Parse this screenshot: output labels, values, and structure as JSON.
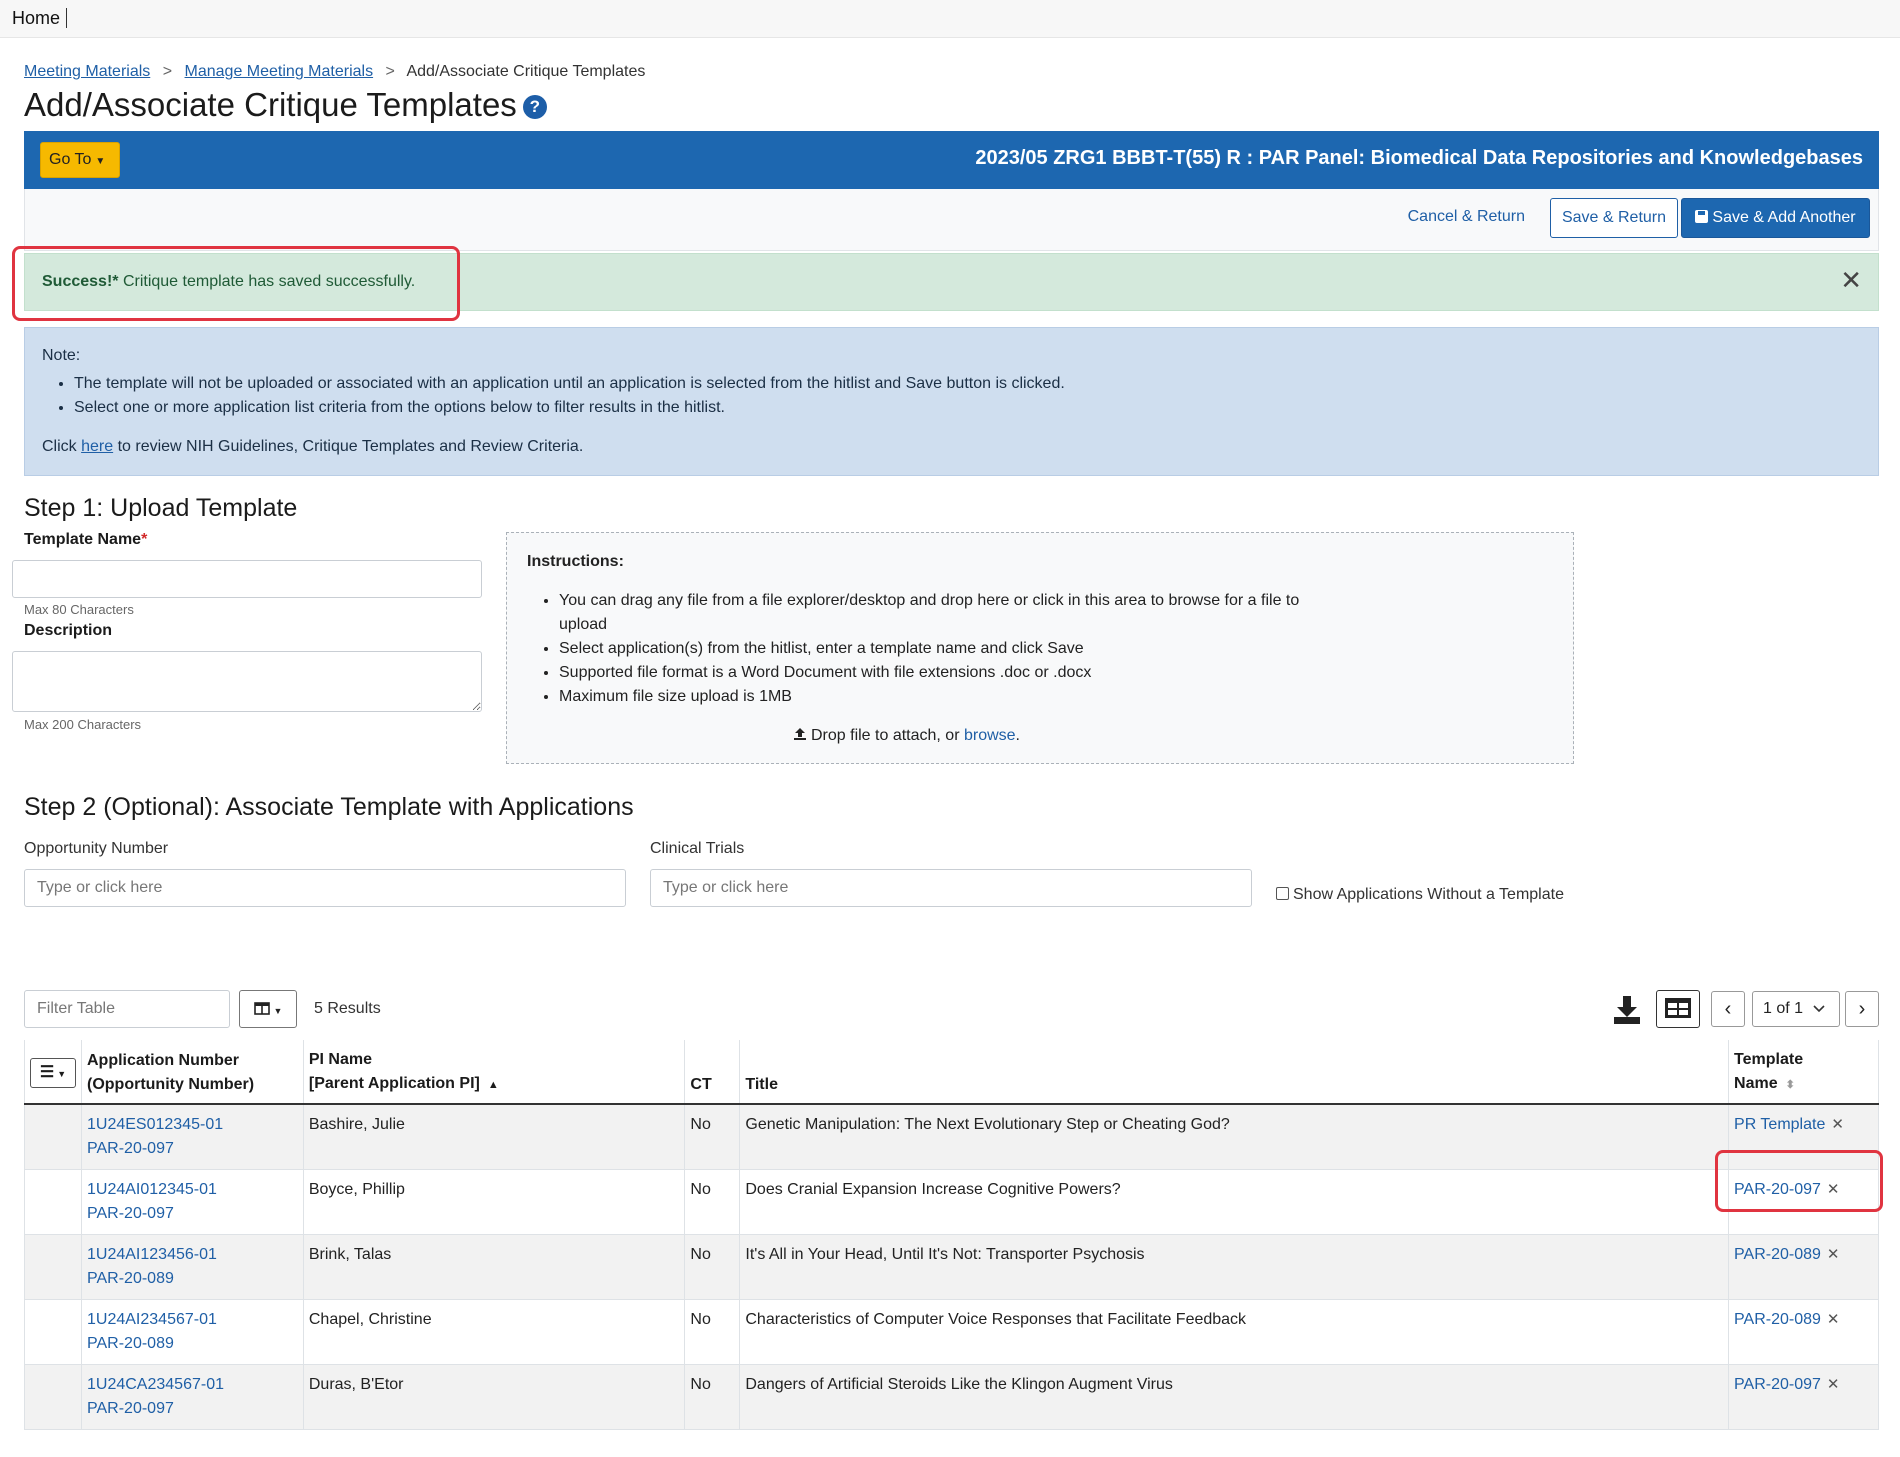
{
  "topbar": {
    "home": "Home"
  },
  "breadcrumb": {
    "items": [
      "Meeting Materials",
      "Manage Meeting Materials"
    ],
    "current": "Add/Associate Critique Templates",
    "separator": ">"
  },
  "page": {
    "title": "Add/Associate Critique Templates",
    "help_glyph": "?"
  },
  "header_bar": {
    "goto_label": "Go To",
    "meeting_title": "2023/05 ZRG1 BBBT-T(55) R : PAR Panel: Biomedical Data Repositories and Knowledgebases"
  },
  "actions": {
    "cancel_label": "Cancel & Return",
    "save_return_label": "Save & Return",
    "save_add_label": "Save & Add Another"
  },
  "alert": {
    "strong": "Success!*",
    "message": " Critique template has saved successfully.",
    "close": "✕"
  },
  "note": {
    "label": "Note:",
    "bullets": [
      "The template will not be uploaded or associated with an application until an application is selected from the hitlist and Save button is clicked.",
      "Select one or more application list criteria from the options below to filter results in the hitlist."
    ],
    "click_prefix": "Click ",
    "click_link": "here",
    "click_suffix": " to review NIH Guidelines, Critique Templates and Review Criteria."
  },
  "step1": {
    "title": "Step 1: Upload Template",
    "template_name_label": "Template Name",
    "template_name_required": "*",
    "template_name_value": "",
    "template_name_hint": "Max 80 Characters",
    "description_label": "Description",
    "description_value": "",
    "description_hint": "Max 200 Characters",
    "instructions_label": "Instructions:",
    "instructions": [
      "You can drag any file from a file explorer/desktop and drop here or click in this area to browse for a file to upload",
      "Select application(s) from the hitlist, enter a template name and click Save",
      "Supported file format is a Word Document with file extensions .doc or .docx",
      "Maximum file size upload is 1MB"
    ],
    "drop_text": "Drop file to attach, or ",
    "browse_link": "browse",
    "drop_end": "."
  },
  "step2": {
    "title": "Step 2 (Optional): Associate Template with Applications",
    "opportunity_label": "Opportunity Number",
    "opportunity_placeholder": "Type or click here",
    "clinical_label": "Clinical Trials",
    "clinical_placeholder": "Type or click here",
    "show_without_label": "Show Applications Without a Template"
  },
  "table_toolbar": {
    "filter_placeholder": "Filter Table",
    "results": "5 Results",
    "page_select": "1 of 1",
    "prev": "‹",
    "next": "›"
  },
  "table": {
    "headers": {
      "app_line1": "Application Number",
      "app_line2": "(Opportunity Number)",
      "pi_line1": "PI Name",
      "pi_line2": "[Parent Application PI]",
      "ct": "CT",
      "title": "Title",
      "tpl_line1": "Template",
      "tpl_line2": "Name"
    },
    "rows": [
      {
        "app": "1U24ES012345-01",
        "opp": "PAR-20-097",
        "pi": "Bashire, Julie",
        "ct": "No",
        "title": "Genetic Manipulation: The Next Evolutionary Step or Cheating God?",
        "template": "PR Template"
      },
      {
        "app": "1U24AI012345-01",
        "opp": "PAR-20-097",
        "pi": "Boyce, Phillip",
        "ct": "No",
        "title": "Does Cranial Expansion Increase Cognitive Powers?",
        "template": "PAR-20-097"
      },
      {
        "app": "1U24AI123456-01",
        "opp": "PAR-20-089",
        "pi": "Brink, Talas",
        "ct": "No",
        "title": "It's All in Your Head, Until It's Not: Transporter Psychosis",
        "template": "PAR-20-089"
      },
      {
        "app": "1U24AI234567-01",
        "opp": "PAR-20-089",
        "pi": "Chapel, Christine",
        "ct": "No",
        "title": "Characteristics of Computer Voice Responses that Facilitate Feedback",
        "template": "PAR-20-089"
      },
      {
        "app": "1U24CA234567-01",
        "opp": "PAR-20-097",
        "pi": "Duras, B'Etor",
        "ct": "No",
        "title": "Dangers of Artificial Steroids Like the Klingon Augment Virus",
        "template": "PAR-20-097"
      }
    ]
  },
  "colors": {
    "brand_blue": "#1d67b0",
    "goto_yellow": "#f6b900",
    "success_bg": "#d4e9dc",
    "note_bg": "#cfdeef",
    "highlight_red": "#e03440"
  }
}
